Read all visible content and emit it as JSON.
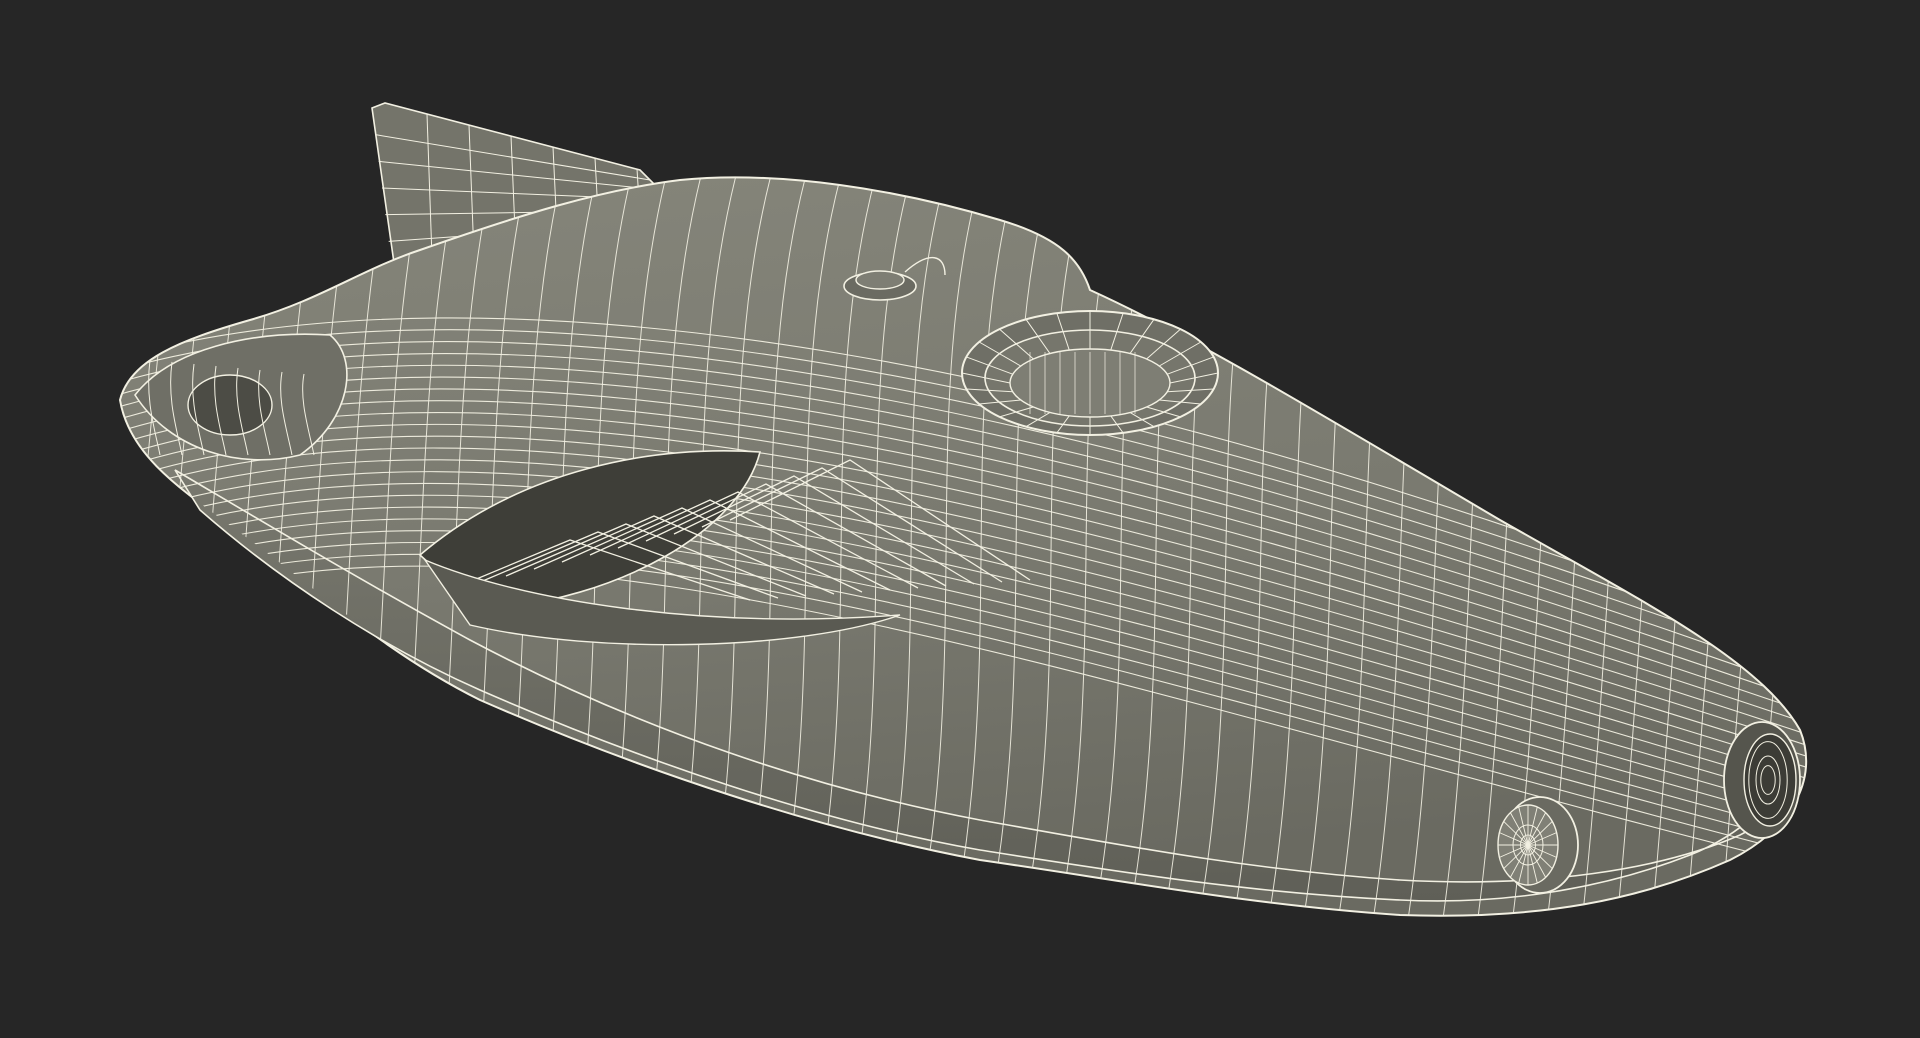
{
  "viewport": {
    "background_color": "#262626"
  },
  "model": {
    "render_style": "wireframe-on-shaded",
    "surface_color": "#7a7a70",
    "surface_shadow_color": "#5a5a52",
    "wire_color": "#f2f0e2",
    "parts": [
      "hull",
      "tail-fin",
      "top-hatch",
      "antenna-mount",
      "side-intake-vent",
      "side-thruster",
      "nose-thruster"
    ]
  }
}
